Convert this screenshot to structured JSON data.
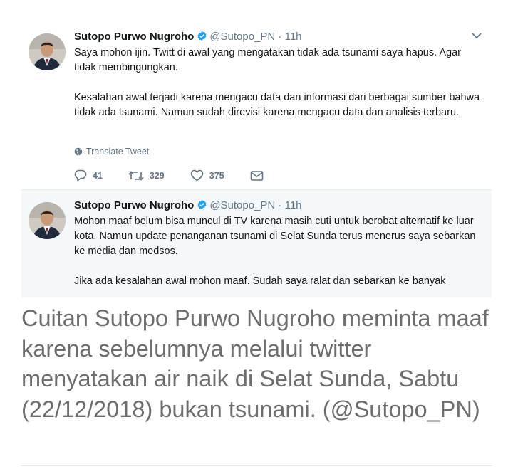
{
  "tweets": [
    {
      "name": "Sutopo Purwo Nugroho",
      "handle": "@Sutopo_PN",
      "separator": "·",
      "time": "11h",
      "paragraphs": [
        "Saya mohon ijin. Twitt di awal yang mengatakan tidak ada tsunami saya hapus. Agar tidak membingungkan.",
        "Kesalahan awal terjadi karena mengacu data dan informasi dari berbagai sumber bahwa tidak ada tsunami. Namun sudah direvisi karena mengacu data dan analisis terbaru."
      ],
      "translate_label": "Translate Tweet",
      "replies": "41",
      "retweets": "329",
      "likes": "375"
    },
    {
      "name": "Sutopo Purwo Nugroho",
      "handle": "@Sutopo_PN",
      "separator": "·",
      "time": "11h",
      "paragraphs": [
        "Mohon maaf belum bisa muncul di TV karena masih cuti untuk berobat alternatif ke luar kota. Namun update penanganan tsunami di Selat Sunda terus menerus saya sebarkan ke media dan medsos.",
        "Jika ada kesalahan awal mohon maaf. Sudah saya ralat dan sebarkan ke banyak"
      ]
    }
  ],
  "caption": "Cuitan Sutopo Purwo Nugroho meminta maaf karena sebelumnya melalui twitter menyatakan air naik di Selat Sunda, Sabtu (22/12/2018) bukan tsunami. (@Sutopo_PN)",
  "colors": {
    "verified": "#1da1f2",
    "icon_gray": "#657786",
    "caption_text": "#6e6e6e"
  }
}
